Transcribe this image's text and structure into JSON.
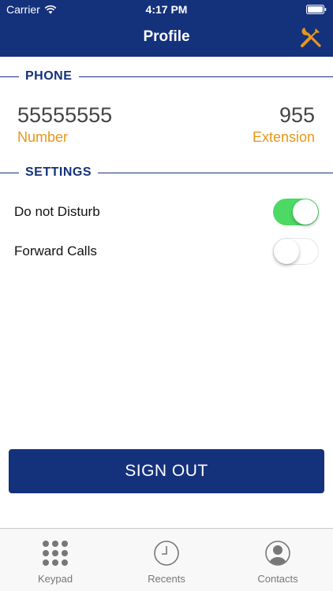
{
  "status_bar": {
    "carrier": "Carrier",
    "time": "4:17 PM"
  },
  "nav": {
    "title": "Profile"
  },
  "phone_section": {
    "heading": "PHONE",
    "number": "55555555",
    "number_label": "Number",
    "extension": "955",
    "extension_label": "Extension"
  },
  "settings_section": {
    "heading": "SETTINGS",
    "items": [
      {
        "label": "Do not Disturb",
        "enabled": true
      },
      {
        "label": "Forward Calls",
        "enabled": false
      }
    ]
  },
  "signout": {
    "label": "SIGN OUT"
  },
  "tab_bar": {
    "items": [
      {
        "label": "Keypad",
        "icon": "keypad-icon"
      },
      {
        "label": "Recents",
        "icon": "clock-icon"
      },
      {
        "label": "Contacts",
        "icon": "contact-icon"
      }
    ]
  },
  "colors": {
    "primary": "#14317c",
    "accent": "#e8961a",
    "toggle_on": "#4cd964",
    "tab_icon": "#777777"
  }
}
